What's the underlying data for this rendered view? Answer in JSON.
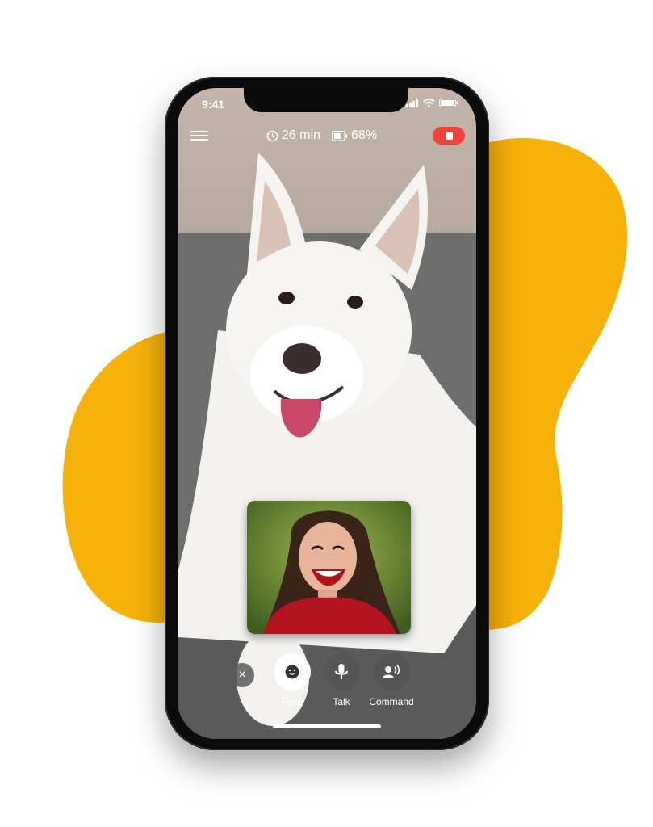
{
  "status": {
    "time": "9:41"
  },
  "call": {
    "duration_label": "26 min",
    "battery_label": "68%"
  },
  "controls": {
    "close_symbol": "×",
    "face_label": "Face",
    "talk_label": "Talk",
    "command_label": "Command"
  },
  "colors": {
    "blob": "#F6B10A",
    "stop_button": "#F0443A",
    "background": "#FFFFFF"
  },
  "icons": [
    "menu-icon",
    "clock-icon",
    "battery-icon",
    "stop-icon",
    "close-icon",
    "smiley-icon",
    "microphone-icon",
    "speaking-person-icon",
    "signal-icon",
    "wifi-icon",
    "status-battery-icon"
  ]
}
